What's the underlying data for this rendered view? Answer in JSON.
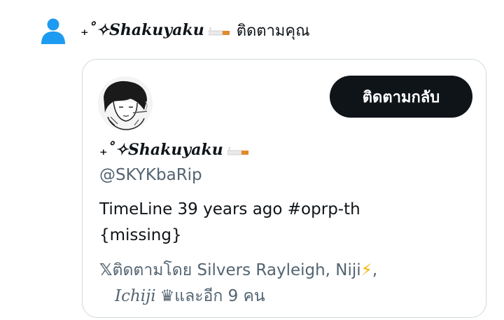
{
  "notification": {
    "name": "₊˚✧𝑺𝒉𝒂𝒌𝒖𝒚𝒂𝒌𝒖",
    "action": "ติดตามคุณ",
    "icon": "person-icon"
  },
  "card": {
    "follow_button": "ติดตามกลับ",
    "display_name": "₊˚✧𝑺𝒉𝒂𝒌𝒖𝒚𝒂𝒌𝒖",
    "handle": "@SKYKbaRip",
    "bio_line1": "TimeLine 39 years ago #oprp-th",
    "bio_line2": "{missing}",
    "followed_by_x": "𝕏",
    "followed_by_line1": "ติดตามโดย Silvers Rayleigh, Niji ",
    "followed_by_bolt": "⚡",
    "followed_by_comma": " ,",
    "followed_by_ichiji": "Ichiji",
    "followed_by_crown": "♛",
    "followed_by_rest": " และอีก 9 คน"
  },
  "colors": {
    "accent": "#1d9bf0",
    "button_bg": "#0f1419",
    "muted": "#536471",
    "border": "#cfd9de"
  }
}
